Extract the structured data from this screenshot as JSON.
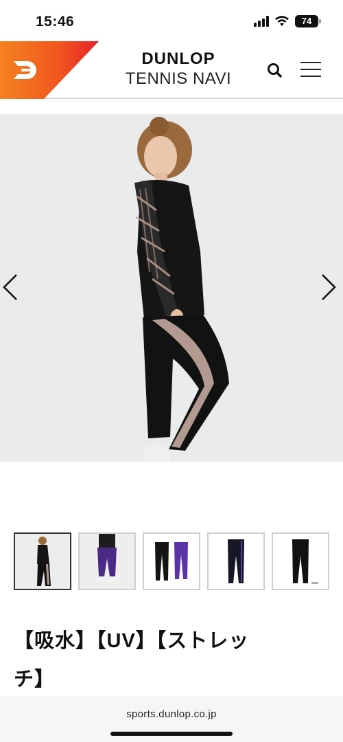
{
  "status_bar": {
    "time": "15:46",
    "battery": "74",
    "icons": [
      "signal-icon",
      "wifi-icon",
      "battery-icon"
    ]
  },
  "header": {
    "brand_name": "DUNLOP",
    "brand_sub": "TENNIS NAVI",
    "logo_icon": "dunlop-logo-icon",
    "search_icon": "search-icon",
    "menu_icon": "hamburger-menu-icon",
    "accent_color": "#f26a1b"
  },
  "carousel": {
    "prev_icon": "chevron-left-icon",
    "next_icon": "chevron-right-icon",
    "thumbnails_count": 5,
    "active_index": 0
  },
  "product": {
    "title_line1": "【吸水】【UV】【ストレッ",
    "title_line2": "チ】"
  },
  "browser": {
    "url": "sports.dunlop.co.jp"
  }
}
